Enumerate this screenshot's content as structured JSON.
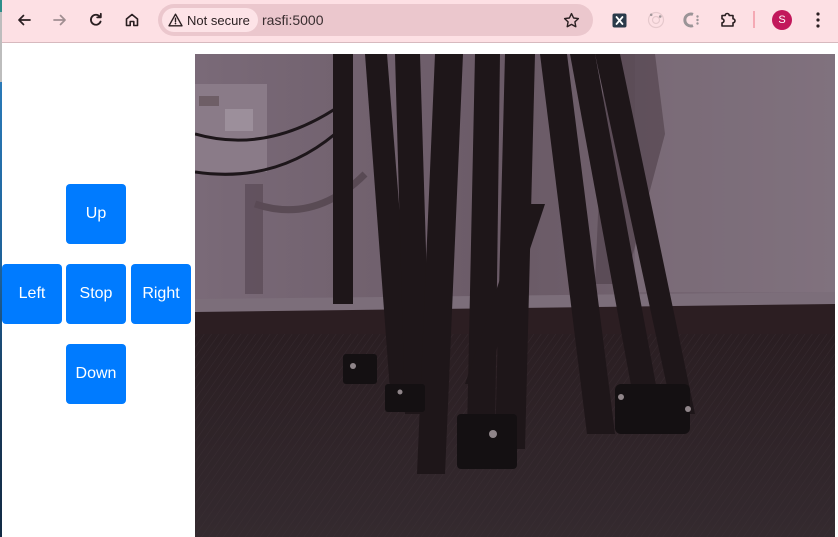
{
  "browser": {
    "nav": {
      "back_icon": "arrow-left-icon",
      "forward_icon": "arrow-right-icon",
      "reload_icon": "reload-icon",
      "home_icon": "home-icon"
    },
    "omnibox": {
      "security_icon": "warning-triangle-icon",
      "security_label": "Not secure",
      "url": "rasfi:5000",
      "bookmark_icon": "star-outline-icon"
    },
    "extensions": [
      {
        "name": "x-extension",
        "icon": "x-square-icon",
        "label": "X"
      },
      {
        "name": "record-extension",
        "icon": "target-icon"
      },
      {
        "name": "c-extension",
        "icon": "c-dots-icon",
        "label": "C"
      },
      {
        "name": "extensions-menu",
        "icon": "puzzle-piece-icon"
      }
    ],
    "profile": {
      "initial": "S",
      "color": "#c2185b"
    },
    "menu_icon": "kebab-menu-icon",
    "theme": {
      "toolbar": "#fde0e4",
      "omnibox": "#ebc7cd"
    }
  },
  "controls": {
    "accent": "#007bff",
    "buttons": {
      "up": "Up",
      "left": "Left",
      "stop": "Stop",
      "right": "Right",
      "down": "Down"
    }
  },
  "video": {
    "description": "camera-stream",
    "scene": "low-light view of tripod/stand legs against a wall with power outlet, carpeted floor"
  }
}
